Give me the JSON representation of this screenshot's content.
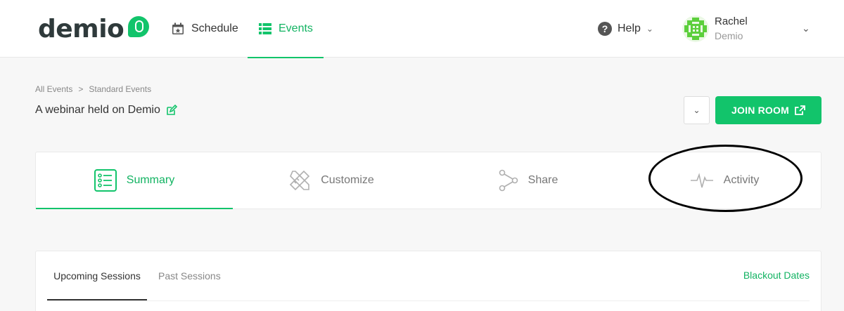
{
  "brand": {
    "name": "demio",
    "accent": "#12c46b"
  },
  "nav": {
    "schedule": "Schedule",
    "events": "Events",
    "help": "Help"
  },
  "user": {
    "name": "Rachel",
    "org": "Demio"
  },
  "breadcrumb": {
    "root": "All Events",
    "separator": ">",
    "current": "Standard Events"
  },
  "page": {
    "title": "A webinar held on Demio",
    "join_label": "JOIN ROOM"
  },
  "tabs": [
    {
      "label": "Summary",
      "icon": "checklist-icon",
      "active": true
    },
    {
      "label": "Customize",
      "icon": "pencil-ruler-icon",
      "active": false
    },
    {
      "label": "Share",
      "icon": "share-icon",
      "active": false
    },
    {
      "label": "Activity",
      "icon": "pulse-icon",
      "active": false
    }
  ],
  "sessions": {
    "tabs": [
      "Upcoming Sessions",
      "Past Sessions"
    ],
    "active_tab": "Upcoming Sessions",
    "blackout_label": "Blackout Dates"
  }
}
